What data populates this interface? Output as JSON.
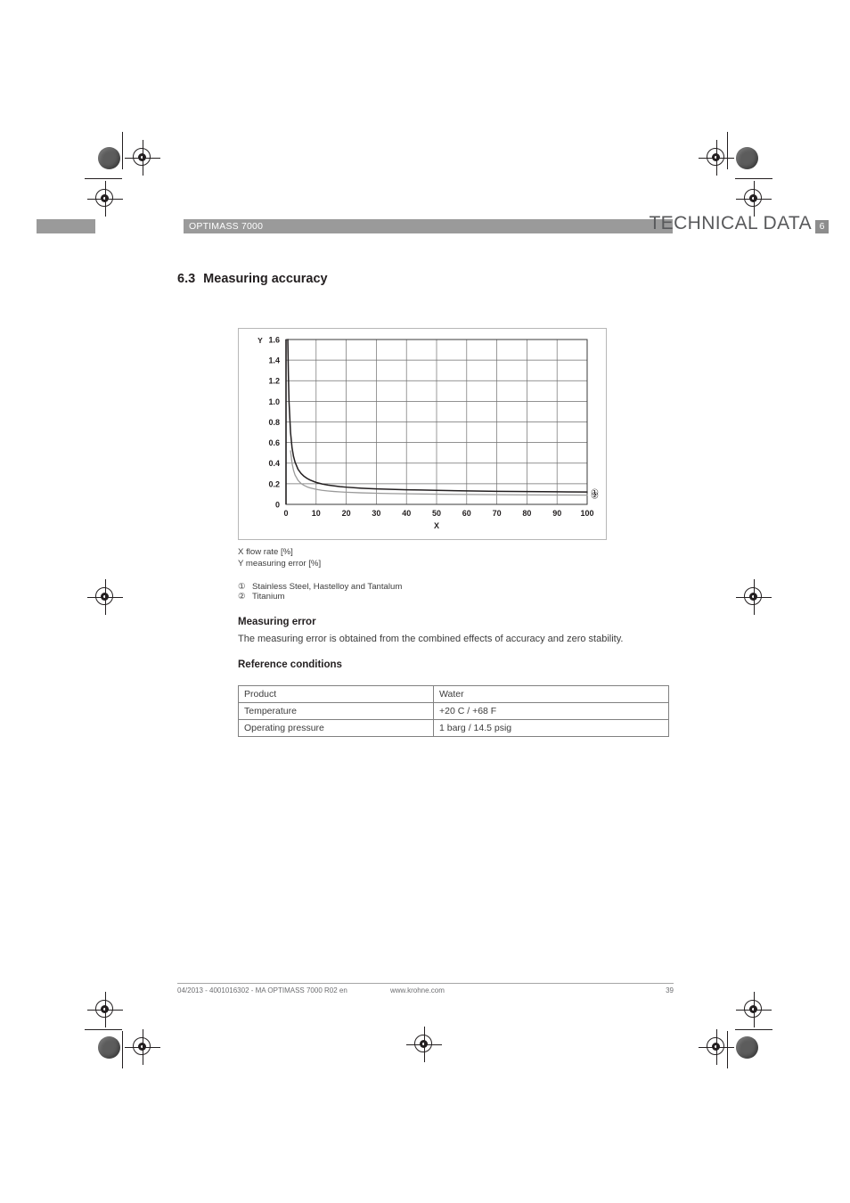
{
  "header": {
    "product": "OPTIMASS 7000",
    "title": "TECHNICAL DATA",
    "chapter": "6"
  },
  "section": {
    "number": "6.3",
    "title": "Measuring accuracy"
  },
  "captions": {
    "x_axis": "X flow rate [%]",
    "y_axis": "Y measuring error [%]"
  },
  "legend": [
    {
      "marker": "①",
      "label": "Stainless Steel, Hastelloy   and Tantalum"
    },
    {
      "marker": "②",
      "label": "Titanium"
    }
  ],
  "measuring_error": {
    "heading": "Measuring error",
    "text": "The measuring error is obtained from the combined effects of accuracy and zero stability."
  },
  "reference_conditions": {
    "heading": "Reference conditions",
    "rows": [
      {
        "key": "Product",
        "value": "Water"
      },
      {
        "key": "Temperature",
        "value": "+20  C / +68  F"
      },
      {
        "key": "Operating pressure",
        "value": "1 barg / 14.5 psig"
      }
    ]
  },
  "footer": {
    "left": "04/2013 - 4001016302 - MA OPTIMASS 7000 R02 en",
    "center": "www.krohne.com",
    "page": "39"
  },
  "chart_data": {
    "type": "line",
    "title": "",
    "xlabel": "X",
    "ylabel": "Y",
    "xlim": [
      0,
      100
    ],
    "ylim": [
      0,
      1.6
    ],
    "xticks": [
      0,
      10,
      20,
      30,
      40,
      50,
      60,
      70,
      80,
      90,
      100
    ],
    "yticks": [
      "0",
      "0.2",
      "0.4",
      "0.6",
      "0.8",
      "1.0",
      "1.2",
      "1.4",
      "1.6"
    ],
    "grid": true,
    "legend_position": "right",
    "axis_letter_x": "X",
    "axis_letter_y": "Y",
    "series": [
      {
        "name": "① Stainless Steel, Hastelloy and Tantalum",
        "color": "#231f20",
        "marker": "①",
        "x": [
          0.6,
          0.8,
          1,
          1.5,
          2,
          2.5,
          3,
          4,
          5,
          6,
          7,
          8,
          10,
          12,
          14,
          16,
          18,
          20,
          25,
          30,
          35,
          40,
          45,
          50,
          60,
          70,
          80,
          90,
          100
        ],
        "y": [
          1.6,
          1.25,
          1.0,
          0.7,
          0.55,
          0.465,
          0.41,
          0.34,
          0.3,
          0.272,
          0.252,
          0.236,
          0.213,
          0.198,
          0.187,
          0.179,
          0.172,
          0.167,
          0.157,
          0.15,
          0.146,
          0.142,
          0.139,
          0.136,
          0.131,
          0.127,
          0.124,
          0.122,
          0.12
        ]
      },
      {
        "name": "② Titanium",
        "color": "#9a9a9a",
        "marker": "②",
        "x": [
          1.5,
          2,
          2.5,
          3,
          4,
          5,
          6,
          7,
          8,
          10,
          12,
          14,
          16,
          18,
          20,
          25,
          30,
          35,
          40,
          50,
          60,
          70,
          80,
          90,
          100
        ],
        "y": [
          0.52,
          0.4,
          0.33,
          0.285,
          0.233,
          0.203,
          0.184,
          0.17,
          0.16,
          0.146,
          0.136,
          0.13,
          0.125,
          0.121,
          0.118,
          0.112,
          0.108,
          0.105,
          0.103,
          0.099,
          0.096,
          0.094,
          0.092,
          0.091,
          0.09
        ]
      }
    ]
  }
}
